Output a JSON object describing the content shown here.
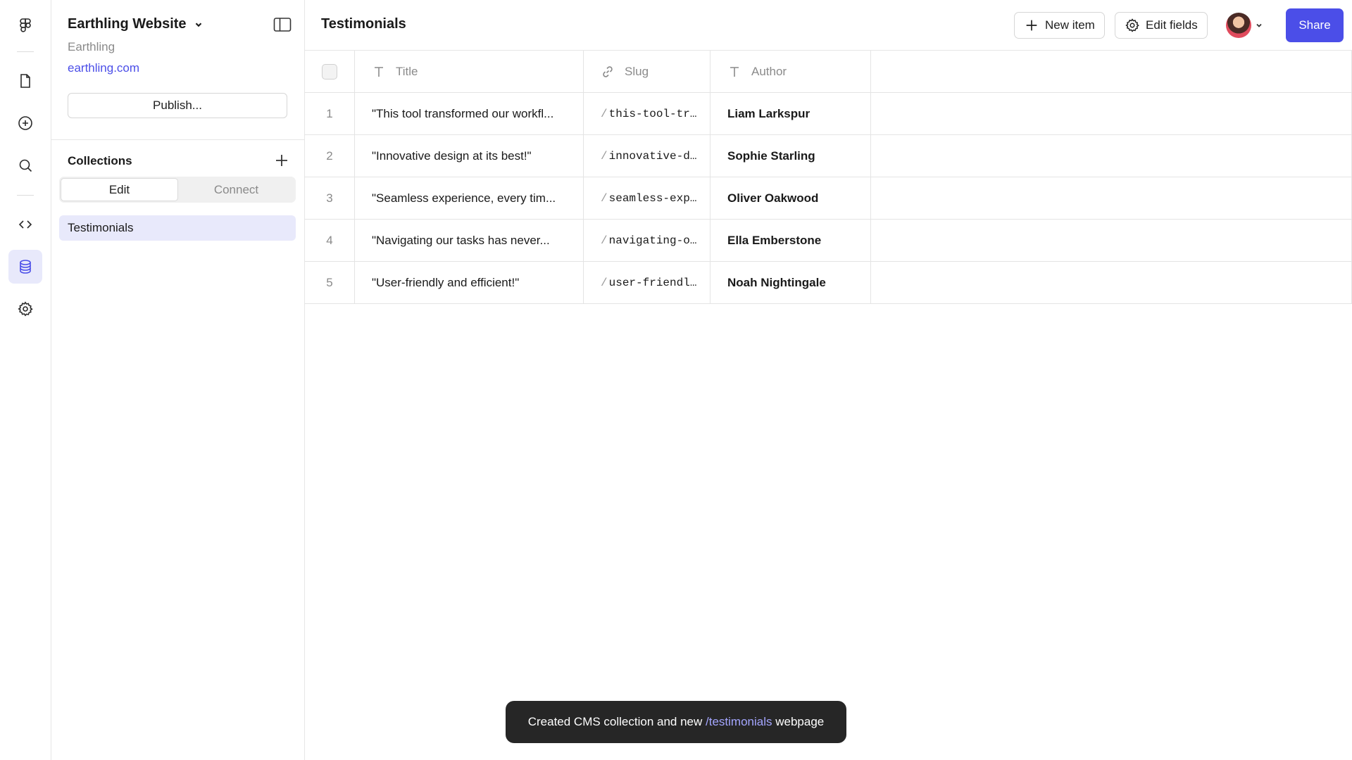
{
  "panel": {
    "project_title": "Earthling Website",
    "org": "Earthling",
    "domain": "earthling.com",
    "publish_label": "Publish...",
    "collections_title": "Collections",
    "segments": [
      "Edit",
      "Connect"
    ],
    "collections": [
      "Testimonials"
    ]
  },
  "header": {
    "title": "Testimonials",
    "new_item_label": "New item",
    "edit_fields_label": "Edit fields",
    "share_label": "Share"
  },
  "table": {
    "columns": [
      "Title",
      "Slug",
      "Author"
    ],
    "rows": [
      {
        "num": "1",
        "title": "\"This tool transformed our workfl...",
        "slug": "this-tool-tr…",
        "author": "Liam Larkspur"
      },
      {
        "num": "2",
        "title": "\"Innovative design at its best!\"",
        "slug": "innovative-d…",
        "author": "Sophie Starling"
      },
      {
        "num": "3",
        "title": "\"Seamless experience, every tim...",
        "slug": "seamless-exp…",
        "author": "Oliver Oakwood"
      },
      {
        "num": "4",
        "title": "\"Navigating our tasks has never...",
        "slug": "navigating-o…",
        "author": "Ella Emberstone"
      },
      {
        "num": "5",
        "title": "\"User-friendly and efficient!\"",
        "slug": "user-friendl…",
        "author": "Noah Nightingale"
      }
    ]
  },
  "toast": {
    "prefix": "Created CMS collection and new",
    "link": "/testimonials",
    "suffix": "webpage"
  },
  "colors": {
    "accent": "#4b4ee8",
    "active_bg": "#e8e9fb",
    "toast_bg": "#262626"
  }
}
